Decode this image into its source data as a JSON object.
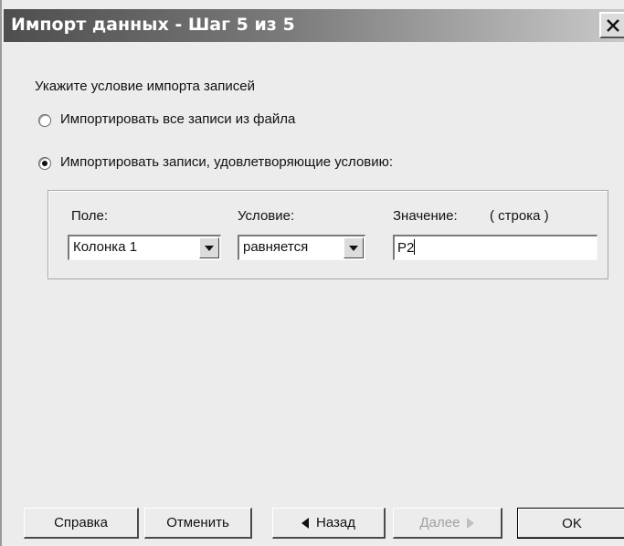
{
  "window": {
    "title": "Импорт данных - Шаг 5 из 5",
    "close_icon": "close-icon"
  },
  "instruction": "Укажите условие импорта записей",
  "options": {
    "all_records": {
      "label": "Импортировать все записи из файла",
      "selected": false
    },
    "conditional_records": {
      "label": "Импортировать записи, удовлетворяющие условию:",
      "selected": true
    }
  },
  "condition": {
    "field_label": "Поле:",
    "field_value": "Колонка 1",
    "operator_label": "Условие:",
    "operator_value": "равняется",
    "value_label": "Значение:",
    "value_type": "( строка )",
    "value": "P2"
  },
  "buttons": {
    "help": "Справка",
    "cancel": "Отменить",
    "back": "Назад",
    "next": "Далее",
    "ok": "OK"
  }
}
